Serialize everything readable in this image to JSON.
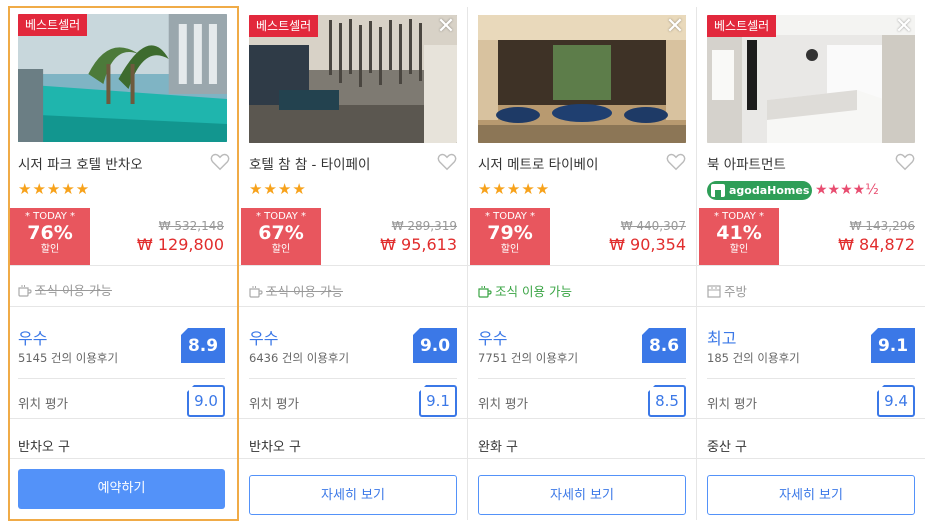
{
  "cards": [
    {
      "bestseller": "베스트셀러",
      "name": "시저 파크 호텔 반차오",
      "stars": "★★★★★",
      "deal": {
        "today": "* TODAY *",
        "pct": "76%",
        "off": "할인"
      },
      "old_price": "₩ 532,148",
      "new_price": "₩ 129,800",
      "amenity": "조식 이용 가능",
      "rating_word": "우수",
      "reviews": "5145 건의 이용후기",
      "score": "8.9",
      "location_label": "위치 평가",
      "location_score": "9.0",
      "district": "반차오 구",
      "button": "예약하기"
    },
    {
      "bestseller": "베스트셀러",
      "name": "호텔 참 참 - 타이페이",
      "stars": "★★★★",
      "deal": {
        "today": "* TODAY *",
        "pct": "67%",
        "off": "할인"
      },
      "old_price": "₩ 289,319",
      "new_price": "₩ 95,613",
      "amenity": "조식 이용 가능",
      "rating_word": "우수",
      "reviews": "6436 건의 이용후기",
      "score": "9.0",
      "location_label": "위치 평가",
      "location_score": "9.1",
      "district": "반차오 구",
      "button": "자세히 보기"
    },
    {
      "name": "시저 메트로 타이베이",
      "stars": "★★★★★",
      "deal": {
        "today": "* TODAY *",
        "pct": "79%",
        "off": "할인"
      },
      "old_price": "₩ 440,307",
      "new_price": "₩ 90,354",
      "amenity": "조식 이용 가능",
      "rating_word": "우수",
      "reviews": "7751 건의 이용후기",
      "score": "8.6",
      "location_label": "위치 평가",
      "location_score": "8.5",
      "district": "완화 구",
      "button": "자세히 보기"
    },
    {
      "bestseller": "베스트셀러",
      "name": "북 아파트먼트",
      "agoda": "agodaHomes",
      "stars": "★★★★½",
      "deal": {
        "today": "* TODAY *",
        "pct": "41%",
        "off": "할인"
      },
      "old_price": "₩ 143,296",
      "new_price": "₩ 84,872",
      "amenity": "주방",
      "rating_word": "최고",
      "reviews": "185 건의 이용후기",
      "score": "9.1",
      "location_label": "위치 평가",
      "location_score": "9.4",
      "district": "중산 구",
      "button": "자세히 보기"
    }
  ],
  "colors": {
    "accent": "#5392f9",
    "deal": "#e8565e",
    "bestseller": "#e2283c",
    "selected_border": "#f0ab47",
    "star": "#f7a21b"
  }
}
